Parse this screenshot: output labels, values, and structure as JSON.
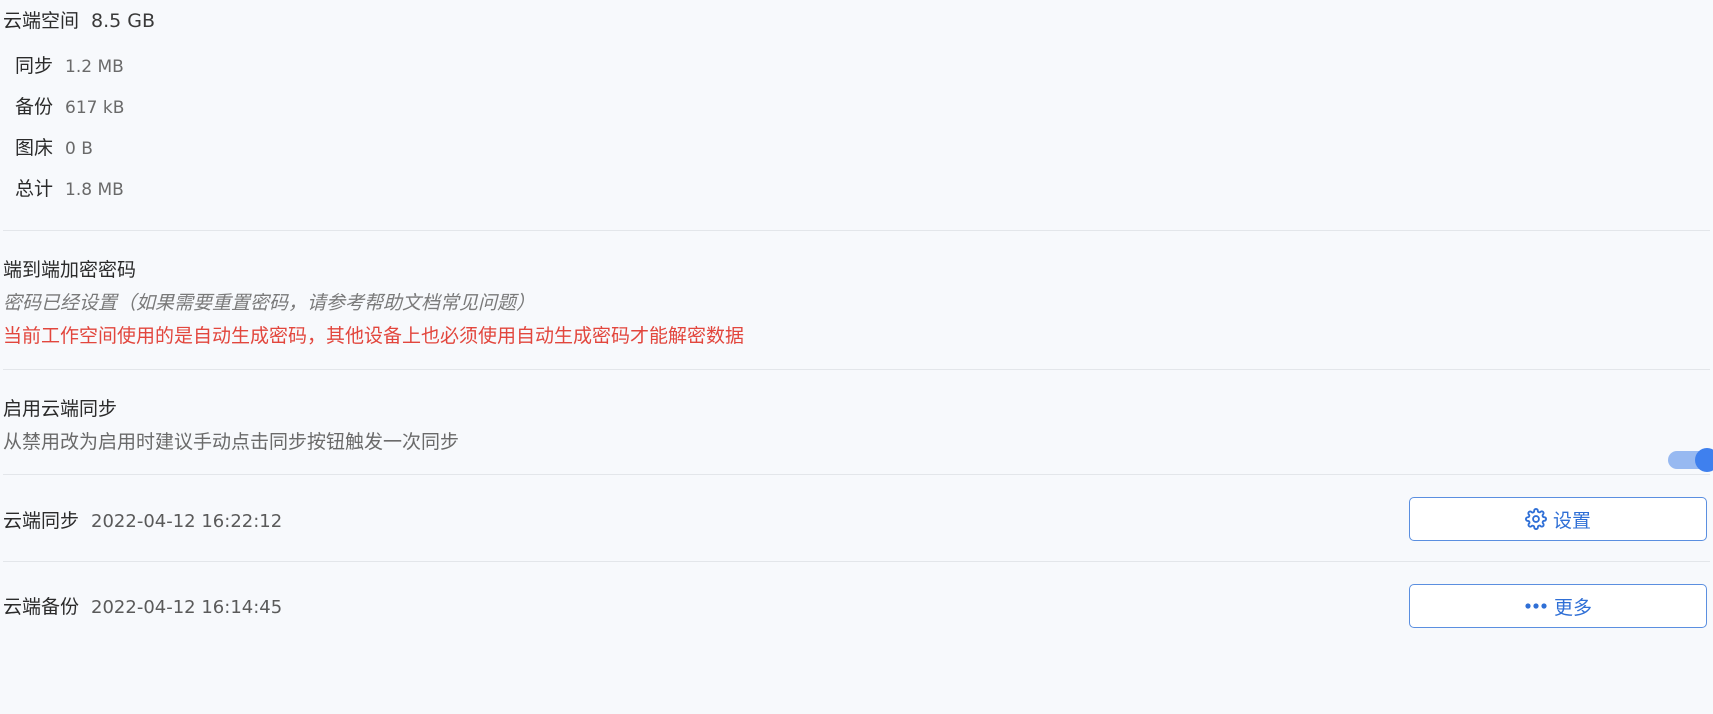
{
  "storage": {
    "title": "云端空间",
    "total_capacity": "8.5 GB",
    "rows": [
      {
        "label": "同步",
        "value": "1.2 MB"
      },
      {
        "label": "备份",
        "value": "617 kB"
      },
      {
        "label": "图床",
        "value": "0 B"
      },
      {
        "label": "总计",
        "value": "1.8 MB"
      }
    ]
  },
  "encryption": {
    "title": "端到端加密密码",
    "status": "密码已经设置（如果需要重置密码，请参考帮助文档常见问题）",
    "warning": "当前工作空间使用的是自动生成密码，其他设备上也必须使用自动生成密码才能解密数据",
    "warning_color": "#e2463d"
  },
  "cloud_sync_toggle": {
    "title": "启用云端同步",
    "description": "从禁用改为启用时建议手动点击同步按钮触发一次同步",
    "enabled": true,
    "accent_color": "#3f80ee"
  },
  "sync": {
    "label": "云端同步",
    "timestamp": "2022-04-12 16:22:12",
    "button_label": "设置",
    "button_icon": "gear-icon"
  },
  "backup": {
    "label": "云端备份",
    "timestamp": "2022-04-12 16:14:45",
    "button_label": "更多",
    "button_icon": "more-dots-icon"
  }
}
